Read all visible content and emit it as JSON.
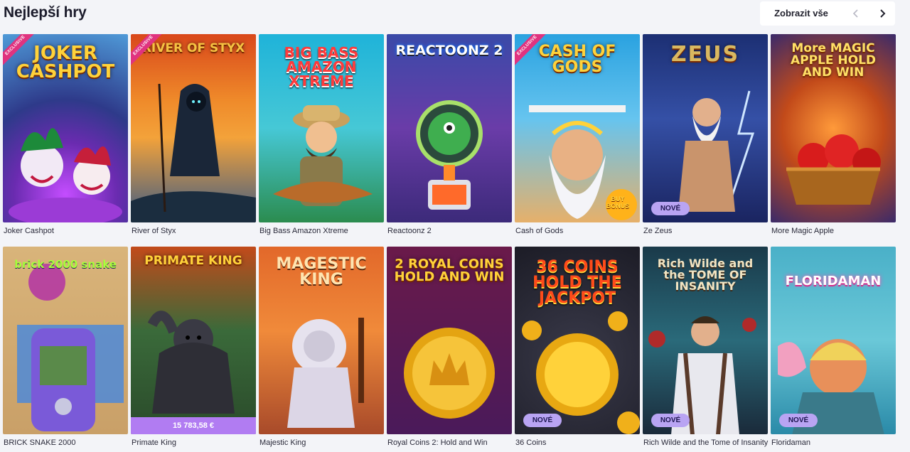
{
  "section": {
    "title": "Nejlepší hry",
    "show_all_label": "Zobrazit vše",
    "prev_icon": "chevron-left-icon",
    "next_icon": "chevron-right-icon"
  },
  "badges": {
    "exclusive": "EXCLUSIVE",
    "new": "NOVÉ"
  },
  "games_row1": [
    {
      "name": "Joker Cashpot",
      "logo": "JOKER CASHPOT",
      "exclusive": true
    },
    {
      "name": "River of Styx",
      "logo": "RIVER OF STYX",
      "exclusive": true
    },
    {
      "name": "Big Bass Amazon Xtreme",
      "logo": "BIG BASS AMAZON XTREME"
    },
    {
      "name": "Reactoonz 2",
      "logo": "REACTOONZ 2"
    },
    {
      "name": "Cash of Gods",
      "logo": "CASH OF GODS",
      "exclusive": true,
      "art_badge": "BUY BONUS"
    },
    {
      "name": "Ze Zeus",
      "logo": "ZEUS",
      "new": true
    },
    {
      "name": "More Magic Apple",
      "logo": "More MAGIC APPLE HOLD AND WIN"
    }
  ],
  "games_row2": [
    {
      "name": "BRICK SNAKE 2000",
      "logo": "brick 2000 snake"
    },
    {
      "name": "Primate King",
      "logo": "PRIMATE KING",
      "jackpot": "15 783,58 €"
    },
    {
      "name": "Majestic King",
      "logo": "MAGESTIC KING"
    },
    {
      "name": "Royal Coins 2: Hold and Win",
      "logo": "2 ROYAL COINS HOLD AND WIN"
    },
    {
      "name": "36 Coins",
      "logo": "36 COINS HOLD THE JACKPOT",
      "new": true
    },
    {
      "name": "Rich Wilde and the Tome of Insanity",
      "logo": "Rich Wilde and the TOME OF INSANITY",
      "new": true
    },
    {
      "name": "Floridaman",
      "logo": "FLORIDAMAN",
      "new": true
    }
  ],
  "colors": {
    "page_bg": "#f3f4f8",
    "exclusive_ribbon": "#e0337f",
    "new_badge": "#b9a4f3",
    "jackpot_bar": "#b17cf2"
  }
}
